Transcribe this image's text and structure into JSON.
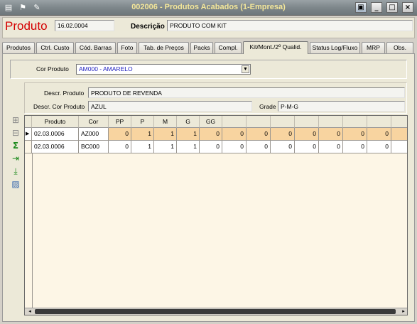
{
  "window": {
    "title": "002006 - Produtos Acabados (1-Empresa)",
    "controls": [
      "_",
      "□",
      "×"
    ]
  },
  "header": {
    "produto_label": "Produto",
    "produto_value": "16.02.0004",
    "descricao_label": "Descrição",
    "descricao_value": "PRODUTO COM KIT"
  },
  "tabs": [
    {
      "label": "Produtos",
      "active": false
    },
    {
      "label": "Ctrl. Custo",
      "active": false
    },
    {
      "label": "Cód. Barras",
      "active": false
    },
    {
      "label": "Foto",
      "active": false
    },
    {
      "label": "Tab. de Preços",
      "active": false
    },
    {
      "label": "Packs",
      "active": false
    },
    {
      "label": "Compl.",
      "active": false
    },
    {
      "label": "Kit/Mont./2º Qualid.",
      "active": true
    },
    {
      "label": "Status Log/Fluxo",
      "active": false
    },
    {
      "label": "MRP",
      "active": false
    },
    {
      "label": "Obs.",
      "active": false
    }
  ],
  "cor_produto": {
    "label": "Cor Produto",
    "value": "AM000 - AMARELO"
  },
  "info": {
    "descr_produto_label": "Descr. Produto",
    "descr_produto_value": "PRODUTO DE REVENDA",
    "descr_cor_label": "Descr. Cor Produto",
    "descr_cor_value": "AZUL",
    "grade_label": "Grade",
    "grade_value": "P-M-G"
  },
  "toolbar_icons": [
    "insert-row-icon",
    "delete-row-icon",
    "sum-icon",
    "export-icon",
    "download-icon",
    "image-icon"
  ],
  "grid": {
    "headers": [
      "Produto",
      "Cor",
      "PP",
      "P",
      "M",
      "G",
      "GG",
      "",
      "",
      "",
      "",
      "",
      ""
    ],
    "rows": [
      {
        "produto": "02.03.0006",
        "cor": "AZ000",
        "values": [
          "0",
          "1",
          "1",
          "1",
          "0",
          "0",
          "0",
          "0",
          "0",
          "0",
          "0",
          "0"
        ]
      },
      {
        "produto": "02.03.0006",
        "cor": "BC000",
        "values": [
          "0",
          "1",
          "1",
          "1",
          "0",
          "0",
          "0",
          "0",
          "0",
          "0",
          "0",
          "0"
        ]
      }
    ]
  },
  "colors": {
    "title_text": "#f4e79a",
    "produto_label": "#d40000",
    "selected_row": "#f8d4a0",
    "grid_bg": "#fdf6e6"
  }
}
